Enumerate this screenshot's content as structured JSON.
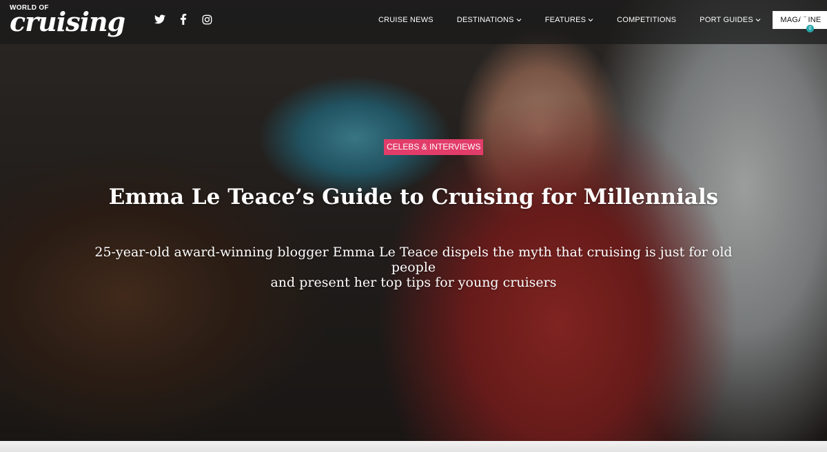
{
  "header": {
    "logo_small": "WORLD OF",
    "logo_big": "cruising",
    "socials": [
      "twitter-icon",
      "facebook-icon",
      "instagram-icon"
    ],
    "nav": [
      {
        "label": "CRUISE NEWS",
        "dropdown": false
      },
      {
        "label": "DESTINATIONS",
        "dropdown": true
      },
      {
        "label": "FEATURES",
        "dropdown": true
      },
      {
        "label": "COMPETITIONS",
        "dropdown": false
      },
      {
        "label": "PORT GUIDES",
        "dropdown": true
      }
    ],
    "magazine_label": "MAGAZINE",
    "cart_count": "0"
  },
  "hero": {
    "category": "CELEBS & INTERVIEWS",
    "title": "Emma Le Teace’s Guide to Cruising for Millennials",
    "subtitle_line1": "25-year-old award-winning blogger Emma Le Teace dispels the myth that cruising is just for old people",
    "subtitle_line2": "and present her top tips for young cruisers"
  },
  "colors": {
    "badge": "#e23d6a",
    "cart_badge": "#2aa6a9",
    "header_bg": "rgba(25,25,25,0.72)"
  }
}
